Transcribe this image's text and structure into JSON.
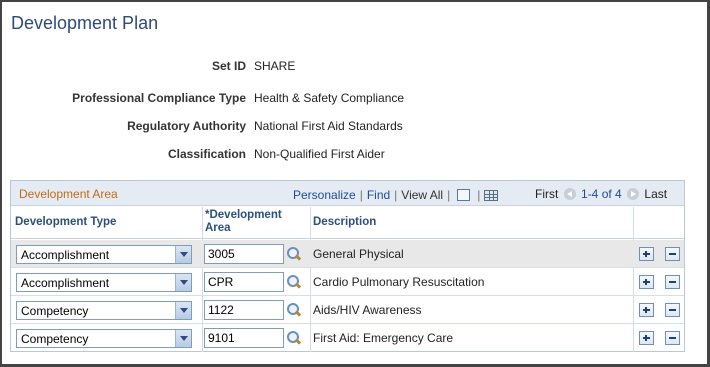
{
  "page": {
    "title": "Development Plan"
  },
  "fields": [
    {
      "label": "Set ID",
      "value": "SHARE"
    },
    {
      "label": "Professional Compliance Type",
      "value": "Health & Safety Compliance"
    },
    {
      "label": "Regulatory Authority",
      "value": "National First Aid Standards"
    },
    {
      "label": "Classification",
      "value": "Non-Qualified First Aider"
    }
  ],
  "grid": {
    "title": "Development Area",
    "personalize": "Personalize",
    "find": "Find",
    "view_all": "View All",
    "first": "First",
    "range": "1-4 of 4",
    "last": "Last",
    "columns": {
      "type": "Development Type",
      "area_line1": "*Development",
      "area_line2": "Area",
      "description": "Description"
    },
    "rows": [
      {
        "type": "Accomplishment",
        "code": "3005",
        "description": "General Physical",
        "selected": true
      },
      {
        "type": "Accomplishment",
        "code": "CPR",
        "description": "Cardio Pulmonary Resuscitation",
        "selected": false
      },
      {
        "type": "Competency",
        "code": "1122",
        "description": "Aids/HIV Awareness",
        "selected": false
      },
      {
        "type": "Competency",
        "code": "9101",
        "description": "First Aid: Emergency Care",
        "selected": false
      }
    ]
  },
  "icons": {
    "lookup": "magnifier-lookup-icon",
    "add": "add-row-icon",
    "delete": "delete-row-icon",
    "new_window": "new-window-icon",
    "download": "grid-download-icon",
    "prev": "previous-arrow-icon"
  },
  "colors": {
    "title": "#2e4a7a",
    "grid_title": "#c06b1a",
    "link": "#1f4b99",
    "selected_row": "#e8e8e8"
  }
}
